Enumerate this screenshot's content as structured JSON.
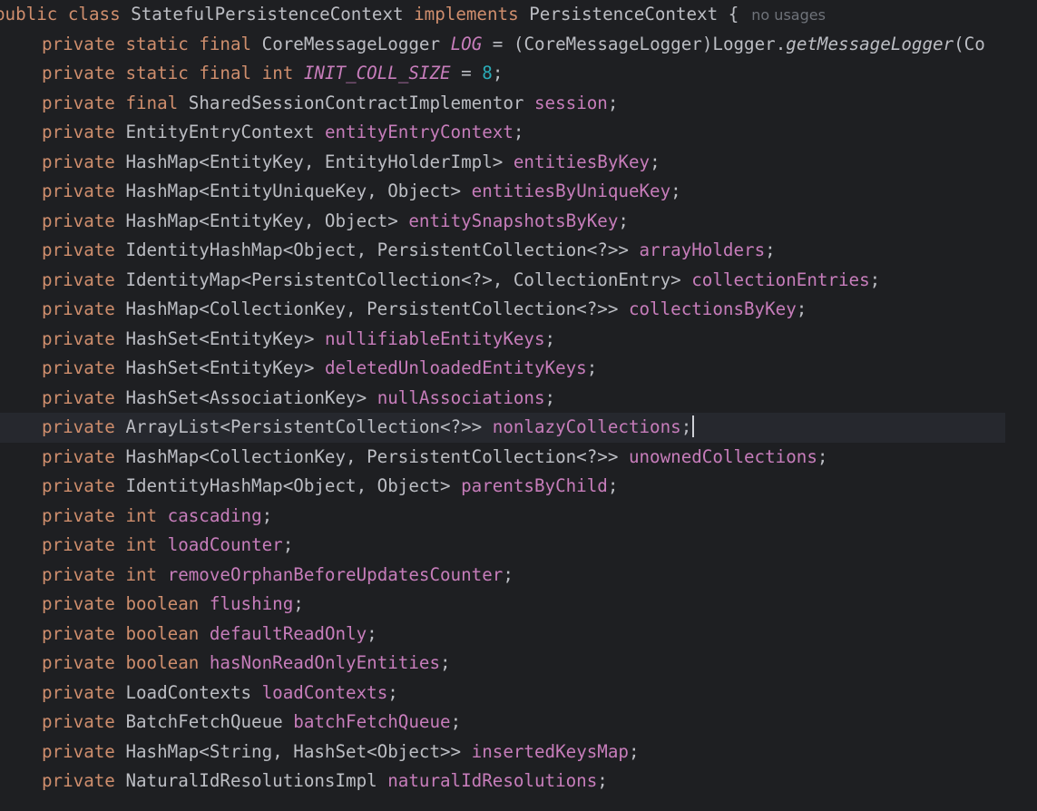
{
  "editor": {
    "header": {
      "modifier": "public",
      "class_kw": "class",
      "class_name": "StatefulPersistenceContext",
      "implements_kw": "implements",
      "interface_name": "PersistenceContext",
      "brace": "{",
      "usages_hint": "no usages"
    },
    "line1": {
      "p1": "private",
      "p2": "static",
      "p3": "final",
      "type": "CoreMessageLogger",
      "name": "LOG",
      "rest1": " = (CoreMessageLogger)Logger.",
      "method": "getMessageLogger",
      "rest2": "(Co"
    },
    "line2": {
      "p1": "private",
      "p2": "static",
      "p3": "final",
      "type": "int",
      "name": "INIT_COLL_SIZE",
      "eq": " = ",
      "value": "8",
      "semi": ";"
    },
    "line3": {
      "p1": "private",
      "p2": "final",
      "type": "SharedSessionContractImplementor",
      "name": "session",
      "semi": ";"
    },
    "fields": [
      {
        "type": "EntityEntryContext",
        "type_is_keyword": false,
        "name": "entityEntryContext"
      },
      {
        "type": "HashMap<EntityKey, EntityHolderImpl>",
        "type_is_keyword": false,
        "name": "entitiesByKey"
      },
      {
        "type": "HashMap<EntityUniqueKey, Object>",
        "type_is_keyword": false,
        "name": "entitiesByUniqueKey"
      },
      {
        "type": "HashMap<EntityKey, Object>",
        "type_is_keyword": false,
        "name": "entitySnapshotsByKey"
      },
      {
        "type": "IdentityHashMap<Object, PersistentCollection<?>>",
        "type_is_keyword": false,
        "name": "arrayHolders"
      },
      {
        "type": "IdentityMap<PersistentCollection<?>, CollectionEntry>",
        "type_is_keyword": false,
        "name": "collectionEntries"
      },
      {
        "type": "HashMap<CollectionKey, PersistentCollection<?>>",
        "type_is_keyword": false,
        "name": "collectionsByKey"
      },
      {
        "type": "HashSet<EntityKey>",
        "type_is_keyword": false,
        "name": "nullifiableEntityKeys"
      },
      {
        "type": "HashSet<EntityKey>",
        "type_is_keyword": false,
        "name": "deletedUnloadedEntityKeys"
      },
      {
        "type": "HashSet<AssociationKey>",
        "type_is_keyword": false,
        "name": "nullAssociations"
      },
      {
        "type": "ArrayList<PersistentCollection<?>>",
        "type_is_keyword": false,
        "name": "nonlazyCollections",
        "current": true
      },
      {
        "type": "HashMap<CollectionKey, PersistentCollection<?>>",
        "type_is_keyword": false,
        "name": "unownedCollections"
      },
      {
        "type": "IdentityHashMap<Object, Object>",
        "type_is_keyword": false,
        "name": "parentsByChild"
      },
      {
        "type": "int",
        "type_is_keyword": true,
        "name": "cascading"
      },
      {
        "type": "int",
        "type_is_keyword": true,
        "name": "loadCounter"
      },
      {
        "type": "int",
        "type_is_keyword": true,
        "name": "removeOrphanBeforeUpdatesCounter"
      },
      {
        "type": "boolean",
        "type_is_keyword": true,
        "name": "flushing"
      },
      {
        "type": "boolean",
        "type_is_keyword": true,
        "name": "defaultReadOnly"
      },
      {
        "type": "boolean",
        "type_is_keyword": true,
        "name": "hasNonReadOnlyEntities"
      },
      {
        "type": "LoadContexts",
        "type_is_keyword": false,
        "name": "loadContexts"
      },
      {
        "type": "BatchFetchQueue",
        "type_is_keyword": false,
        "name": "batchFetchQueue"
      },
      {
        "type": "HashMap<String, HashSet<Object>>",
        "type_is_keyword": false,
        "name": "insertedKeysMap"
      },
      {
        "type": "NaturalIdResolutionsImpl",
        "type_is_keyword": false,
        "name": "naturalIdResolutions"
      }
    ],
    "field_modifier": "private",
    "semicolon": ";"
  },
  "colors": {
    "background": "#1e1f22",
    "current_line": "#26282e",
    "keyword": "#cf8e6d",
    "field": "#c77dbb",
    "number": "#2aacb8",
    "text": "#bcbec4",
    "hint": "#6f737a"
  }
}
